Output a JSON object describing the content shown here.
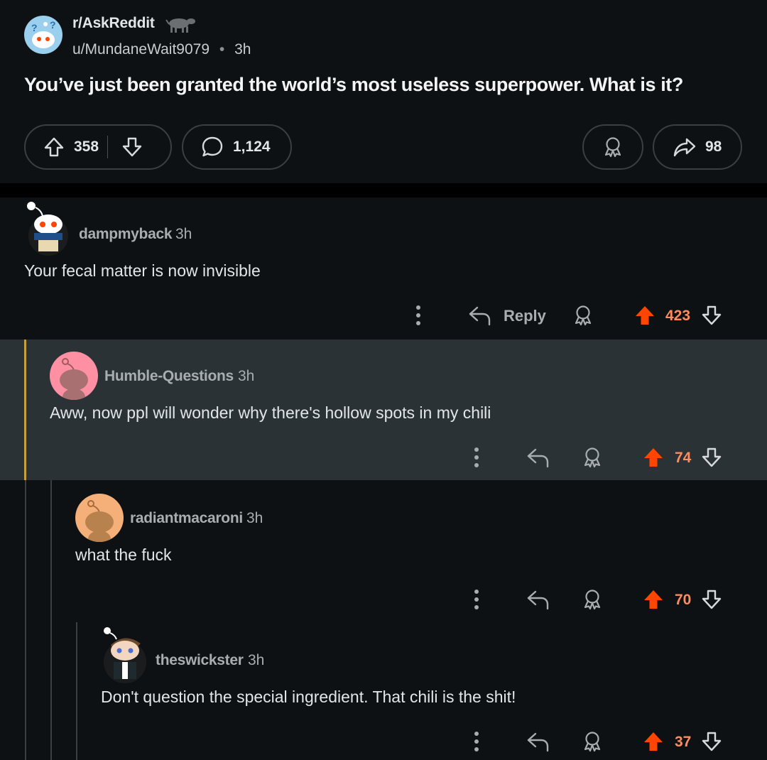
{
  "post": {
    "subreddit": "r/AskReddit",
    "author": "u/MundaneWait9079",
    "separator": "•",
    "time": "3h",
    "title": "You’ve just been granted the world’s most useless superpower. What is it?",
    "upvotes": "358",
    "comments": "1,124",
    "shares": "98"
  },
  "comments": [
    {
      "username": "dampmyback",
      "time": "3h",
      "body": "Your fecal matter is now invisible",
      "reply_label": "Reply",
      "score": "423"
    },
    {
      "username": "Humble-Questions",
      "time": "3h",
      "body": "Aww, now ppl will wonder why there's hollow spots in my chili",
      "score": "74"
    },
    {
      "username": "radiantmacaroni",
      "time": "3h",
      "body": "what the fuck",
      "score": "70"
    },
    {
      "username": "theswickster",
      "time": "3h",
      "body": "Don't question the special ingredient. That chili is the shit!",
      "score": "37"
    }
  ],
  "colors": {
    "background": "#0e1113",
    "highlight": "#2b3236",
    "upvote_active": "#ff4500",
    "score_active": "#ff8b60",
    "thread_highlight": "#c7a03c"
  }
}
